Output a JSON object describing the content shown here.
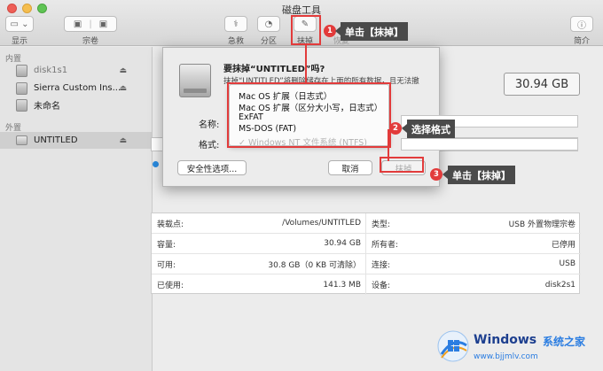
{
  "window": {
    "title": "磁盘工具"
  },
  "toolbar": {
    "display_label": "显示",
    "volume_label": "宗卷",
    "first_aid_label": "急救",
    "partition_label": "分区",
    "erase_label": "抹掉",
    "restore_label": "恢复",
    "info_label": "简介"
  },
  "sidebar": {
    "internal_header": "内置",
    "external_header": "外置",
    "items": [
      {
        "label": "disk1s1",
        "dim": true
      },
      {
        "label": "Sierra Custom Ins..."
      },
      {
        "label": "未命名"
      },
      {
        "label": "UNTITLED",
        "selected": true
      }
    ]
  },
  "main": {
    "capacity": "30.94 GB"
  },
  "info_table": {
    "left": [
      {
        "k": "装载点:",
        "v": "/Volumes/UNTITLED"
      },
      {
        "k": "容量:",
        "v": "30.94 GB"
      },
      {
        "k": "可用:",
        "v": "30.8 GB（0 KB 可清除）"
      },
      {
        "k": "已使用:",
        "v": "141.3 MB"
      }
    ],
    "right": [
      {
        "k": "类型:",
        "v": "USB 外置物理宗卷"
      },
      {
        "k": "所有者:",
        "v": "已停用"
      },
      {
        "k": "连接:",
        "v": "USB"
      },
      {
        "k": "设备:",
        "v": "disk2s1"
      }
    ]
  },
  "dialog": {
    "title": "要抹掉“UNTITLED”吗?",
    "message": "抹掉“UNTITLED”将删除储存在上面的所有数据，且无法撤",
    "name_label": "名称:",
    "format_label": "格式:",
    "security_button": "安全性选项...",
    "cancel_button": "取消",
    "erase_button": "抹掉"
  },
  "format_menu": {
    "options": [
      "Mac OS 扩展（日志式）",
      "Mac OS 扩展（区分大小写，日志式）",
      "ExFAT",
      "MS-DOS (FAT)",
      "✓ Windows NT 文件系统 (NTFS)"
    ]
  },
  "annotations": {
    "step1_num": "1",
    "step1_text": "单击【抹掉】",
    "step2_num": "2",
    "step2_text": "选择格式",
    "step3_num": "3",
    "step3_text": "单击【抹掉】",
    "accent_color": "#e23b3b"
  },
  "watermark": {
    "brand": "Windows",
    "brand_cn": "系统之家",
    "url": "www.bjjmlv.com"
  }
}
